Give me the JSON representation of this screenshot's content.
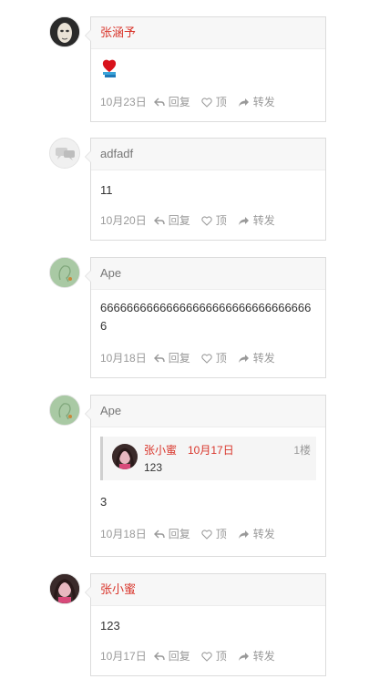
{
  "comments": [
    {
      "author": "张涵予",
      "author_color": "red",
      "content": "",
      "has_emoji": true,
      "date": "10月23日"
    },
    {
      "author": "adfadf",
      "author_color": "gray",
      "content": "11",
      "date": "10月20日"
    },
    {
      "author": "Ape",
      "author_color": "gray",
      "content": "666666666666666666666666666666666",
      "date": "10月18日"
    },
    {
      "author": "Ape",
      "author_color": "gray",
      "content": "3",
      "date": "10月18日",
      "quote": {
        "author": "张小蜜",
        "date": "10月17日",
        "floor": "1楼",
        "text": "123"
      }
    },
    {
      "author": "张小蜜",
      "author_color": "red",
      "content": "123",
      "date": "10月17日"
    }
  ],
  "actions": {
    "reply": "回复",
    "like": "顶",
    "share": "转发"
  },
  "colors": {
    "accent_red": "#d9362c",
    "muted": "#999999",
    "border": "#dcdcdc",
    "header_bg": "#f7f7f7"
  },
  "icons": {
    "reply": "reply-arrow-icon",
    "like": "heart-outline-icon",
    "share": "share-arrow-icon"
  }
}
